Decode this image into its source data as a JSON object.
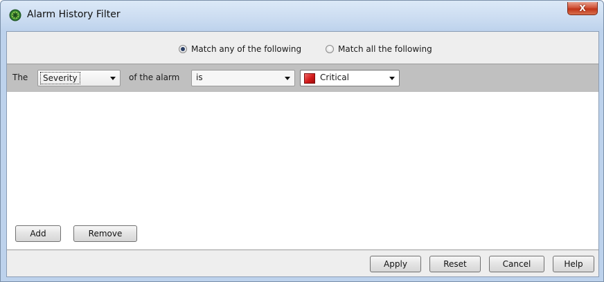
{
  "window": {
    "title": "Alarm History Filter",
    "close_label": "X"
  },
  "match": {
    "any_label": "Match any of the following",
    "all_label": "Match all the following",
    "selected": "any"
  },
  "criteria": {
    "prefix": "The",
    "field_value": "Severity",
    "middle": "of the alarm",
    "operator_value": "is",
    "severity_value": "Critical",
    "severity_color": "#d21a1a"
  },
  "list_buttons": {
    "add_label": "Add",
    "remove_label": "Remove"
  },
  "dialog_buttons": {
    "apply_label": "Apply",
    "reset_label": "Reset",
    "cancel_label": "Cancel",
    "help_label": "Help"
  },
  "icons": {
    "app": "green-gear-icon",
    "close": "close-icon",
    "dropdown": "chevron-down-icon",
    "severity": "severity-critical-swatch"
  }
}
